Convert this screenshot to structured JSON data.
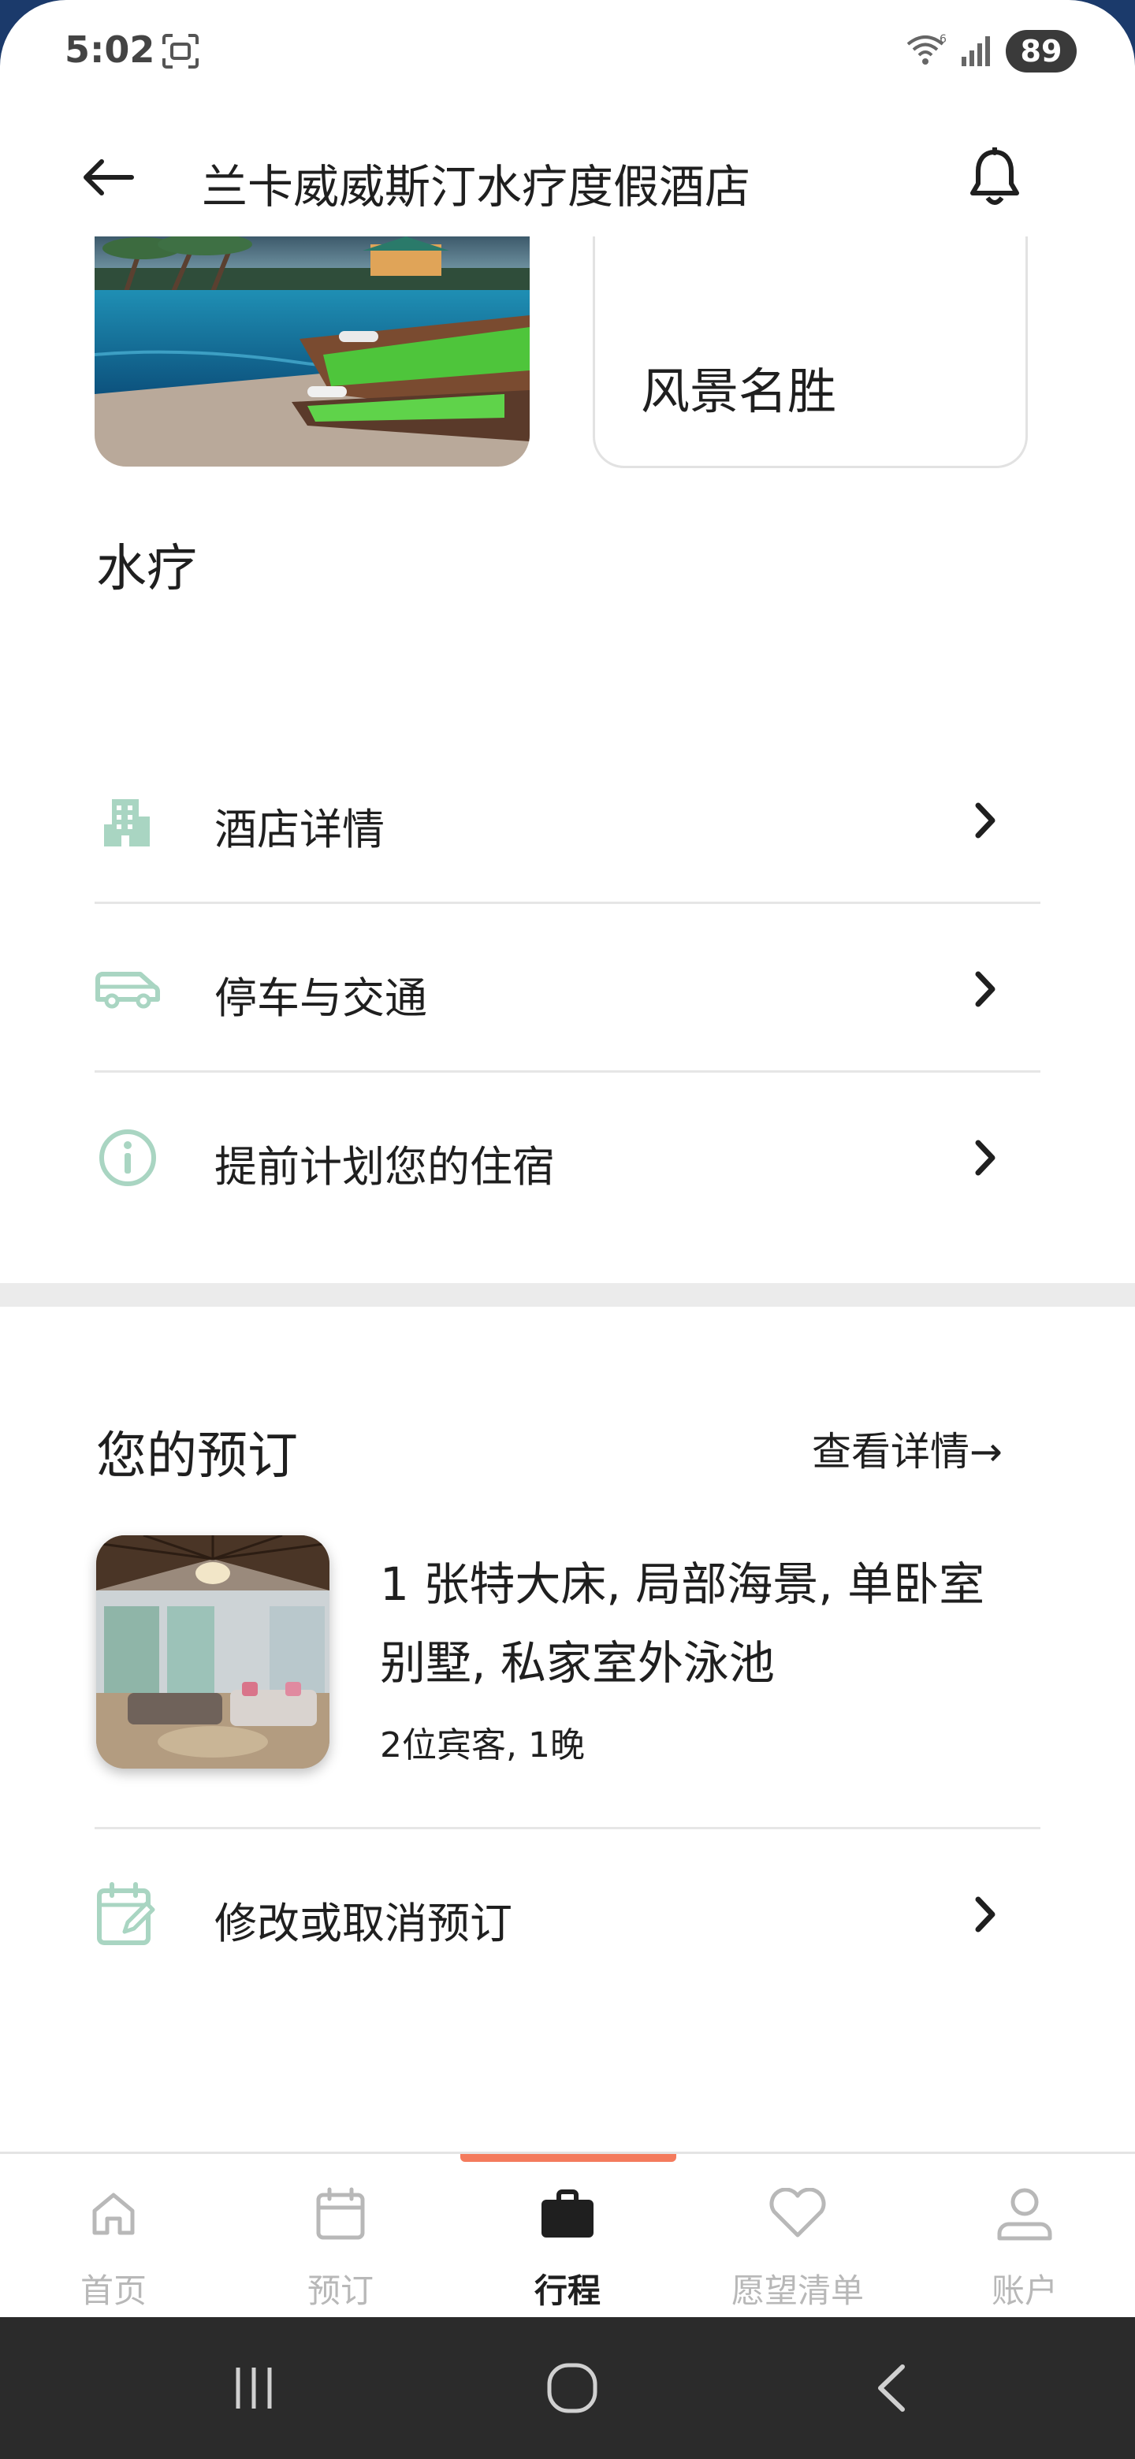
{
  "status_bar": {
    "time": "5:02",
    "battery": "89"
  },
  "app_bar": {
    "title": "兰卡威威斯汀水疗度假酒店"
  },
  "cards": {
    "scenic_label": "风景名胜",
    "spa_label": "水疗"
  },
  "info_list": {
    "items": [
      {
        "label": "酒店详情",
        "icon": "building-icon"
      },
      {
        "label": "停车与交通",
        "icon": "car-icon"
      },
      {
        "label": "提前计划您的住宿",
        "icon": "info-icon"
      }
    ]
  },
  "booking": {
    "title": "您的预订",
    "view_details": "查看详情→",
    "room_name": "1 张特大床, 局部海景, 单卧室别墅, 私家室外泳池",
    "guests": "2位宾客, 1晚",
    "modify_label": "修改或取消预订"
  },
  "bottom_nav": {
    "items": [
      {
        "label": "首页",
        "icon": "home-icon",
        "active": false
      },
      {
        "label": "预订",
        "icon": "calendar-icon",
        "active": false
      },
      {
        "label": "行程",
        "icon": "briefcase-icon",
        "active": true
      },
      {
        "label": "愿望清单",
        "icon": "heart-icon",
        "active": false
      },
      {
        "label": "账户",
        "icon": "person-icon",
        "active": false
      }
    ]
  },
  "colors": {
    "accent": "#f47b5d",
    "icon_tint": "#a9d5c2",
    "text": "#1f1f1f",
    "inactive": "#b8b8b8"
  }
}
